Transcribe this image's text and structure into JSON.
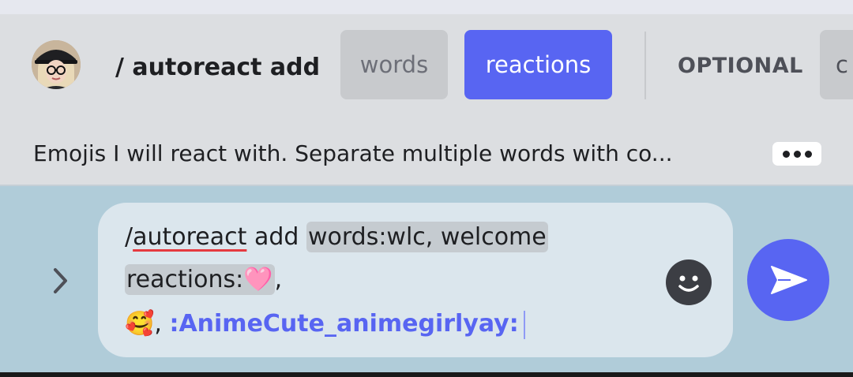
{
  "command": {
    "name": "/ autoreact add",
    "avatar_icon": "user-avatar",
    "chips": {
      "words": "words",
      "reactions": "reactions",
      "optional": "OPTIONAL",
      "cut": "c"
    },
    "description": "Emojis I will react with. Separate multiple words with co...",
    "more_icon": "ellipsis-icon"
  },
  "composer": {
    "slash": "/",
    "command_word": "autoreact",
    "rest": " add ",
    "words_arg": "words:wlc, welcome",
    "reactions_key": "reactions:",
    "emoji_heart": "🩷",
    "sep1": ",",
    "emoji_face": "🥰",
    "sep2": ",",
    "custom_emoji": ":AnimeCute_animegirlyay:"
  },
  "icons": {
    "expand": "chevron-right-icon",
    "emoji": "emoji-icon",
    "send": "send-icon"
  },
  "colors": {
    "accent": "#5865f2",
    "composer_bg": "#b0ccd9",
    "input_bg": "#dbe6ed",
    "cmd_bar_bg": "#dcdee1",
    "spell_underline": "#e53a40"
  }
}
